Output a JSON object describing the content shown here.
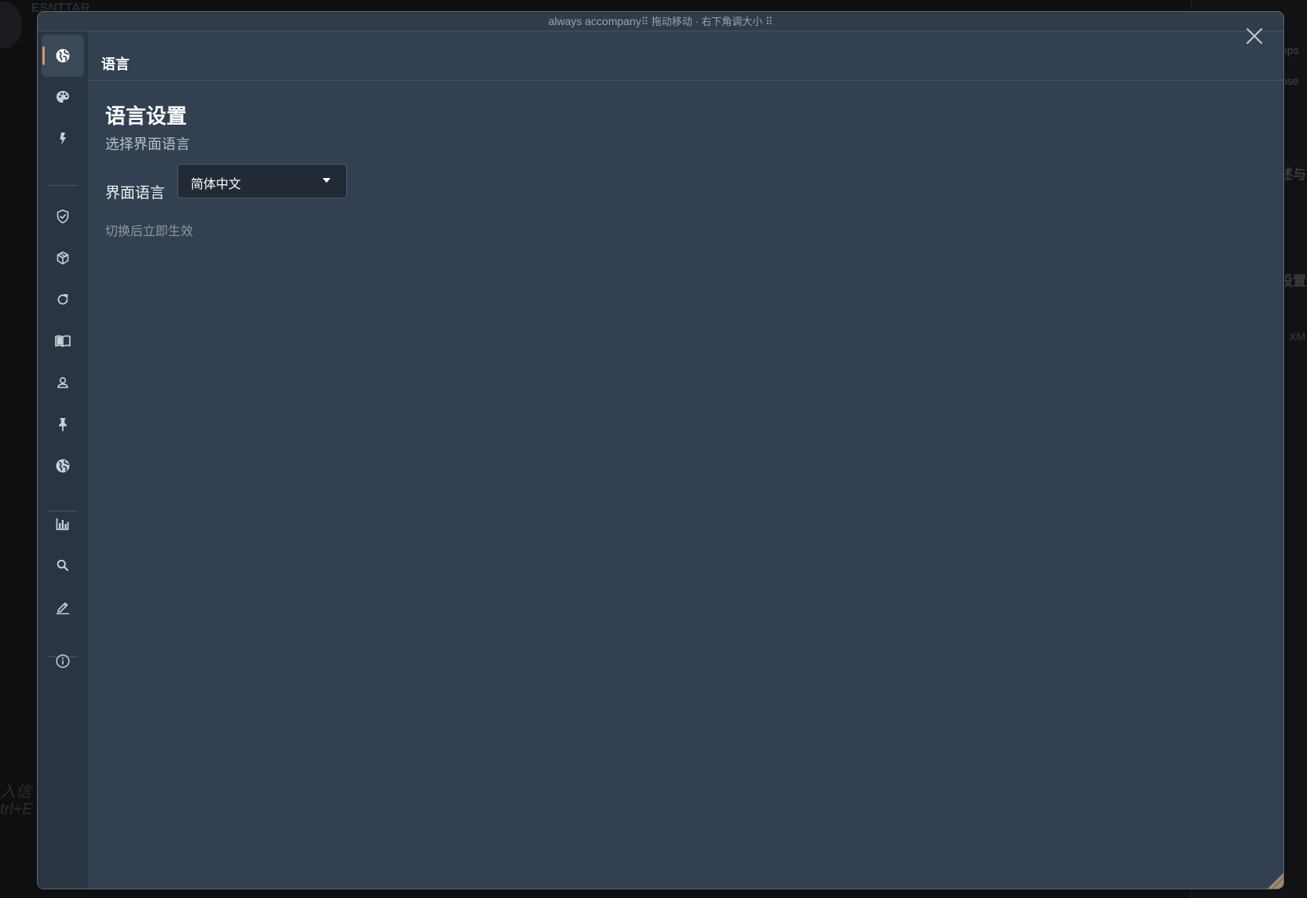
{
  "window": {
    "app_name": "always accompany",
    "hint": "⠿ 拖动移动 · 右下角调大小 ⠿"
  },
  "sidebar": {
    "items": [
      {
        "id": "language",
        "icon": "globe-icon",
        "active": true
      },
      {
        "id": "appearance",
        "icon": "palette-icon"
      },
      {
        "id": "shortcuts",
        "icon": "lightning-icon"
      },
      {
        "id": "privacy",
        "icon": "shield-check-icon"
      },
      {
        "id": "models",
        "icon": "cube-icon"
      },
      {
        "id": "sync",
        "icon": "refresh-icon"
      },
      {
        "id": "knowledge",
        "icon": "book-open-icon"
      },
      {
        "id": "profile",
        "icon": "user-icon"
      },
      {
        "id": "pinned",
        "icon": "pin-icon"
      },
      {
        "id": "network",
        "icon": "globe-icon"
      },
      {
        "id": "statistics",
        "icon": "bar-chart-icon"
      },
      {
        "id": "search",
        "icon": "search-icon"
      },
      {
        "id": "editor",
        "icon": "pencil-icon"
      },
      {
        "id": "about",
        "icon": "info-icon"
      }
    ]
  },
  "section": {
    "title": "语言"
  },
  "main": {
    "title": "语言设置",
    "subtitle": "选择界面语言",
    "field_label": "界面语言",
    "select_value": "简体中文",
    "hint": "切换后立即生效"
  },
  "colors": {
    "panel": "#334051",
    "sidebar": "#2a3542",
    "accent": "#d39a5a",
    "select_bg": "#222b35"
  },
  "background_app": {
    "fragments": [
      "ESNTTAR",
      "入信",
      "trl+E",
      "eps",
      "pse",
      "述与",
      "设置",
      "XM"
    ]
  }
}
